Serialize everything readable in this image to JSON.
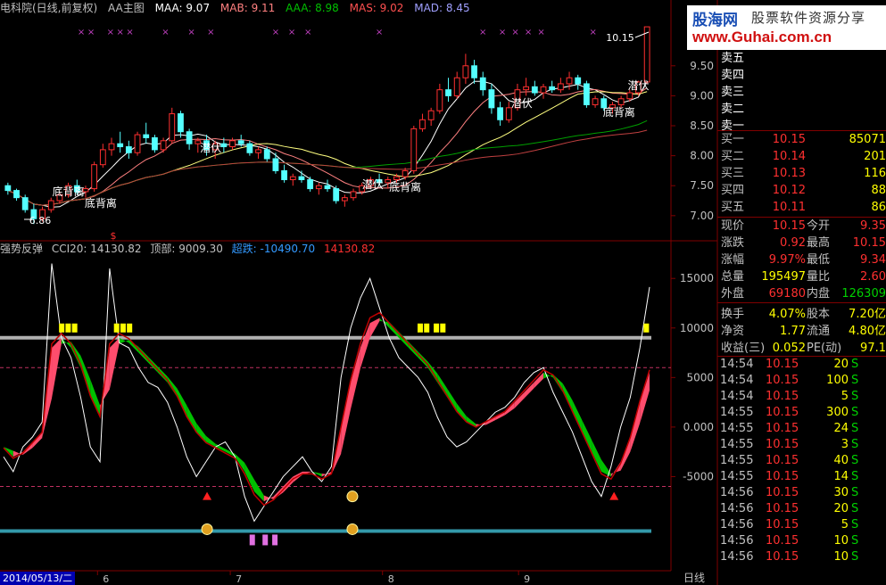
{
  "header": {
    "title": "电科院(日线,前复权)",
    "indicator": "AA主图",
    "maa": "MAA: 9.07",
    "mab": "MAB: 9.11",
    "aaa": "AAA: 8.98",
    "mas": "MAS: 9.02",
    "mad": "MAD: 8.45"
  },
  "indicator_header": {
    "name": "强势反弹",
    "cci": "CCI20: 14130.82",
    "top": "顶部: 9009.30",
    "oversold": "超跌: -10490.70",
    "value": "14130.82"
  },
  "logo": {
    "name": "股海网",
    "slogan": "股票软件资源分享",
    "url": "www.Guhai.com.cn"
  },
  "colors": {
    "bg": "#000000",
    "up": "#ff3030",
    "down": "#54ffff",
    "pink": "#ff4d6d",
    "green": "#00c000",
    "grid": "#800000",
    "gold": "#ffff00",
    "teal": "#3399aa"
  },
  "chart_data": [
    {
      "type": "candlestick",
      "title": "电科院(日线,前复权)",
      "ylim": [
        6.7,
        10.3
      ],
      "yticks": [
        "7.00",
        "7.50",
        "8.00",
        "8.50",
        "9.00",
        "9.50"
      ],
      "x_ticks": [
        "6",
        "7",
        "8",
        "9"
      ],
      "annotations": [
        "底背离",
        "底背离",
        "潜伏",
        "潜伏",
        "底背离",
        "潜伏",
        "潜伏",
        "底背离",
        "10.15",
        "6.86"
      ],
      "ohlc": [
        [
          7.5,
          7.55,
          7.35,
          7.42
        ],
        [
          7.42,
          7.45,
          7.25,
          7.3
        ],
        [
          7.3,
          7.35,
          7.05,
          7.1
        ],
        [
          7.1,
          7.2,
          6.86,
          6.95
        ],
        [
          6.95,
          7.15,
          6.9,
          7.1
        ],
        [
          7.1,
          7.3,
          7.05,
          7.25
        ],
        [
          7.25,
          7.4,
          7.2,
          7.35
        ],
        [
          7.35,
          7.55,
          7.3,
          7.5
        ],
        [
          7.5,
          7.6,
          7.35,
          7.4
        ],
        [
          7.4,
          7.5,
          7.3,
          7.45
        ],
        [
          7.45,
          7.9,
          7.4,
          7.85
        ],
        [
          7.85,
          8.2,
          7.8,
          8.1
        ],
        [
          8.1,
          8.3,
          8.0,
          8.2
        ],
        [
          8.2,
          8.4,
          8.05,
          8.15
        ],
        [
          8.15,
          8.25,
          7.95,
          8.05
        ],
        [
          8.05,
          8.4,
          8.0,
          8.35
        ],
        [
          8.35,
          8.55,
          8.2,
          8.3
        ],
        [
          8.3,
          8.35,
          8.05,
          8.1
        ],
        [
          8.1,
          8.3,
          8.05,
          8.25
        ],
        [
          8.25,
          8.8,
          8.2,
          8.7
        ],
        [
          8.7,
          8.75,
          8.3,
          8.4
        ],
        [
          8.4,
          8.45,
          8.1,
          8.2
        ],
        [
          8.2,
          8.3,
          8.05,
          8.25
        ],
        [
          8.25,
          8.35,
          8.0,
          8.1
        ],
        [
          8.1,
          8.25,
          7.95,
          8.2
        ],
        [
          8.2,
          8.3,
          8.05,
          8.15
        ],
        [
          8.15,
          8.3,
          8.1,
          8.25
        ],
        [
          8.25,
          8.35,
          8.15,
          8.2
        ],
        [
          8.2,
          8.25,
          8.0,
          8.05
        ],
        [
          8.05,
          8.15,
          7.95,
          8.1
        ],
        [
          8.1,
          8.15,
          7.9,
          7.95
        ],
        [
          7.95,
          8.05,
          7.7,
          7.75
        ],
        [
          7.75,
          7.85,
          7.55,
          7.6
        ],
        [
          7.6,
          7.7,
          7.5,
          7.65
        ],
        [
          7.65,
          7.75,
          7.55,
          7.6
        ],
        [
          7.6,
          7.65,
          7.4,
          7.45
        ],
        [
          7.45,
          7.55,
          7.35,
          7.5
        ],
        [
          7.5,
          7.6,
          7.4,
          7.45
        ],
        [
          7.45,
          7.5,
          7.2,
          7.25
        ],
        [
          7.25,
          7.35,
          7.15,
          7.3
        ],
        [
          7.3,
          7.45,
          7.25,
          7.4
        ],
        [
          7.4,
          7.55,
          7.35,
          7.5
        ],
        [
          7.5,
          7.65,
          7.45,
          7.6
        ],
        [
          7.6,
          7.7,
          7.5,
          7.55
        ],
        [
          7.55,
          7.65,
          7.45,
          7.6
        ],
        [
          7.6,
          7.7,
          7.55,
          7.65
        ],
        [
          7.65,
          7.8,
          7.6,
          7.75
        ],
        [
          7.75,
          8.5,
          7.7,
          8.45
        ],
        [
          8.45,
          8.7,
          8.4,
          8.6
        ],
        [
          8.6,
          8.8,
          8.5,
          8.75
        ],
        [
          8.75,
          9.2,
          8.7,
          9.1
        ],
        [
          9.1,
          9.3,
          8.9,
          9.0
        ],
        [
          9.0,
          9.4,
          8.95,
          9.3
        ],
        [
          9.3,
          9.7,
          9.2,
          9.5
        ],
        [
          9.5,
          9.6,
          9.2,
          9.3
        ],
        [
          9.3,
          9.4,
          9.0,
          9.1
        ],
        [
          9.1,
          9.2,
          8.7,
          8.8
        ],
        [
          8.8,
          8.9,
          8.5,
          8.6
        ],
        [
          8.6,
          8.9,
          8.55,
          8.8
        ],
        [
          8.8,
          9.2,
          8.75,
          9.1
        ],
        [
          9.1,
          9.3,
          9.0,
          9.15
        ],
        [
          9.15,
          9.25,
          9.0,
          9.05
        ],
        [
          9.05,
          9.2,
          8.95,
          9.15
        ],
        [
          9.15,
          9.25,
          9.05,
          9.1
        ],
        [
          9.1,
          9.3,
          9.05,
          9.2
        ],
        [
          9.2,
          9.4,
          9.1,
          9.3
        ],
        [
          9.3,
          9.35,
          9.1,
          9.2
        ],
        [
          9.2,
          9.25,
          8.8,
          8.85
        ],
        [
          8.85,
          9.0,
          8.8,
          8.95
        ],
        [
          8.95,
          9.0,
          8.75,
          8.8
        ],
        [
          8.8,
          8.9,
          8.7,
          8.85
        ],
        [
          8.85,
          9.0,
          8.8,
          8.95
        ],
        [
          8.95,
          9.1,
          8.9,
          9.05
        ],
        [
          9.05,
          9.25,
          9.0,
          9.23
        ],
        [
          9.23,
          10.15,
          9.2,
          10.15
        ]
      ],
      "ma_lines": [
        "MAA",
        "MAB",
        "AAA",
        "MAS",
        "MAD"
      ]
    },
    {
      "type": "line",
      "title": "强势反弹",
      "ylim": [
        -14500,
        17000
      ],
      "yticks": [
        "15000",
        "10000",
        "5000",
        "0.000",
        "-5000"
      ],
      "levels": {
        "top": 9009.3,
        "oversold": -10490.7,
        "upper_dash": 6000,
        "lower_dash": -6000
      },
      "series": [
        {
          "name": "CCI20",
          "values": [
            -3000,
            -4500,
            -2000,
            -1000,
            500,
            16500,
            9000,
            7000,
            3000,
            -2000,
            -3500,
            16000,
            8500,
            8000,
            6000,
            4500,
            4000,
            2500,
            0,
            -3000,
            -5000,
            -3500,
            -2000,
            -1500,
            -3000,
            -7000,
            -9500,
            -8000,
            -6500,
            -5000,
            -4000,
            -3000,
            -4500,
            -5500,
            -4000,
            5000,
            10000,
            13000,
            15000,
            12000,
            9000,
            7000,
            6000,
            5000,
            3500,
            1000,
            -1000,
            -2000,
            -1500,
            -500,
            500,
            1500,
            2000,
            3000,
            4500,
            5500,
            6000,
            3500,
            1500,
            -500,
            -3000,
            -5500,
            -7000,
            -4000,
            0,
            3000,
            8000,
            14130.82
          ]
        },
        {
          "name": "MA",
          "values": [
            -2000,
            -3000,
            -2500,
            -1500,
            -500,
            8000,
            9000,
            8000,
            6000,
            3000,
            1000,
            8000,
            9000,
            8500,
            7500,
            6500,
            5500,
            4500,
            3000,
            1000,
            -500,
            -1500,
            -2000,
            -2500,
            -3000,
            -4500,
            -6500,
            -7500,
            -7000,
            -6000,
            -5000,
            -4500,
            -4500,
            -5000,
            -4500,
            0,
            4500,
            8000,
            10500,
            11000,
            10000,
            9000,
            8000,
            7000,
            6000,
            4500,
            3000,
            1500,
            500,
            0,
            500,
            1000,
            1500,
            2500,
            3500,
            4500,
            5500,
            5000,
            3500,
            1500,
            -500,
            -2500,
            -4500,
            -5000,
            -3500,
            -1000,
            2500,
            5500
          ]
        }
      ],
      "signals": [
        "潜伏",
        "底背离"
      ]
    }
  ],
  "quote": {
    "ask": [
      {
        "label": "卖五",
        "price": "",
        "vol": ""
      },
      {
        "label": "卖四",
        "price": "",
        "vol": ""
      },
      {
        "label": "卖三",
        "price": "",
        "vol": ""
      },
      {
        "label": "卖二",
        "price": "",
        "vol": ""
      },
      {
        "label": "卖一",
        "price": "",
        "vol": ""
      }
    ],
    "bid": [
      {
        "label": "买一",
        "price": "10.15",
        "vol": "85071"
      },
      {
        "label": "买二",
        "price": "10.14",
        "vol": "201"
      },
      {
        "label": "买三",
        "price": "10.13",
        "vol": "116"
      },
      {
        "label": "买四",
        "price": "10.12",
        "vol": "88"
      },
      {
        "label": "买五",
        "price": "10.11",
        "vol": "86"
      }
    ],
    "stats": [
      {
        "l1": "现价",
        "v1": "10.15",
        "l2": "今开",
        "v2": "9.35",
        "c1": "#ff3030",
        "c2": "#ff3030"
      },
      {
        "l1": "涨跌",
        "v1": "0.92",
        "l2": "最高",
        "v2": "10.15",
        "c1": "#ff3030",
        "c2": "#ff3030"
      },
      {
        "l1": "涨幅",
        "v1": "9.97%",
        "l2": "最低",
        "v2": "9.34",
        "c1": "#ff3030",
        "c2": "#ff3030"
      },
      {
        "l1": "总量",
        "v1": "195497",
        "l2": "量比",
        "v2": "2.60",
        "c1": "#ffff00",
        "c2": "#ff3030"
      },
      {
        "l1": "外盘",
        "v1": "69180",
        "l2": "内盘",
        "v2": "126309",
        "c1": "#ff3030",
        "c2": "#00d000"
      },
      {
        "l1": "换手",
        "v1": "4.07%",
        "l2": "股本",
        "v2": "7.20亿",
        "c1": "#ffff00",
        "c2": "#ffff00"
      },
      {
        "l1": "净资",
        "v1": "1.77",
        "l2": "流通",
        "v2": "4.80亿",
        "c1": "#ffff00",
        "c2": "#ffff00"
      },
      {
        "l1": "收益(三)",
        "v1": "0.052",
        "l2": "PE(动)",
        "v2": "97.1",
        "c1": "#ffff00",
        "c2": "#ffff00"
      }
    ],
    "ticks": [
      {
        "t": "14:54",
        "p": "10.15",
        "v": "20",
        "s": "S"
      },
      {
        "t": "14:54",
        "p": "10.15",
        "v": "100",
        "s": "S"
      },
      {
        "t": "14:54",
        "p": "10.15",
        "v": "5",
        "s": "S"
      },
      {
        "t": "14:55",
        "p": "10.15",
        "v": "300",
        "s": "S"
      },
      {
        "t": "14:55",
        "p": "10.15",
        "v": "24",
        "s": "S"
      },
      {
        "t": "14:55",
        "p": "10.15",
        "v": "3",
        "s": "S"
      },
      {
        "t": "14:55",
        "p": "10.15",
        "v": "40",
        "s": "S"
      },
      {
        "t": "14:55",
        "p": "10.15",
        "v": "14",
        "s": "S"
      },
      {
        "t": "14:56",
        "p": "10.15",
        "v": "30",
        "s": "S"
      },
      {
        "t": "14:56",
        "p": "10.15",
        "v": "20",
        "s": "S"
      },
      {
        "t": "14:56",
        "p": "10.15",
        "v": "5",
        "s": "S"
      },
      {
        "t": "14:56",
        "p": "10.15",
        "v": "10",
        "s": "S"
      },
      {
        "t": "14:56",
        "p": "10.15",
        "v": "10",
        "s": "S"
      }
    ]
  },
  "footer": {
    "date": "2014/05/13/二",
    "period": "日线"
  }
}
